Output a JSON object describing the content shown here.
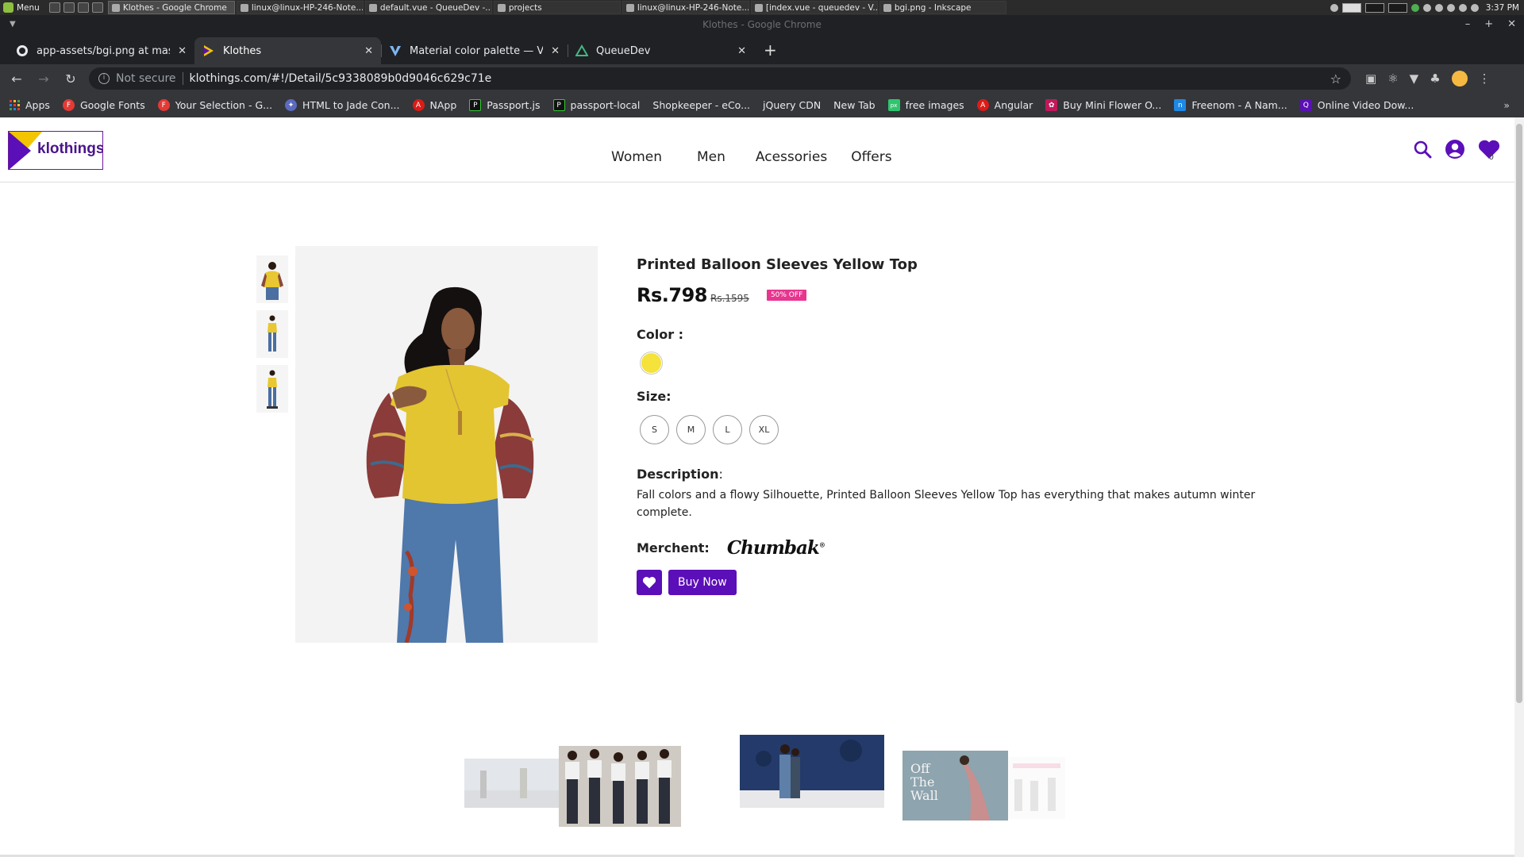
{
  "os_taskbar": {
    "menu_label": "Menu",
    "tasks": [
      {
        "label": "Klothes - Google Chrome",
        "active": true
      },
      {
        "label": "linux@linux-HP-246-Note...",
        "active": false
      },
      {
        "label": "default.vue - QueueDev -...",
        "active": false
      },
      {
        "label": "projects",
        "active": false
      },
      {
        "label": "linux@linux-HP-246-Note...",
        "active": false
      },
      {
        "label": "[index.vue - queuedev - V...",
        "active": false
      },
      {
        "label": "bgi.png - Inkscape",
        "active": false
      }
    ],
    "clock": "3:37 PM"
  },
  "window": {
    "title": "Klothes - Google Chrome"
  },
  "browser": {
    "tabs": [
      {
        "label": "app-assets/bgi.png at master ·",
        "icon": "github-icon",
        "active": false
      },
      {
        "label": "Klothes",
        "icon": "klothes-icon",
        "active": true
      },
      {
        "label": "Material color palette — Vuetify",
        "icon": "vuetify-icon",
        "active": false
      },
      {
        "label": "QueueDev",
        "icon": "queuedev-icon",
        "active": false
      }
    ],
    "security_label": "Not secure",
    "url": "klothings.com/#!/Detail/5c9338089b0d9046c629c71e",
    "bookmarks": [
      {
        "label": "Apps",
        "icon": "apps-grid-icon",
        "color": "#e8710a"
      },
      {
        "label": "Google Fonts",
        "icon": "google-fonts-icon",
        "color": "#e53935"
      },
      {
        "label": "Your Selection - G...",
        "icon": "google-fonts-icon",
        "color": "#e53935"
      },
      {
        "label": "HTML to Jade Con...",
        "icon": "converter-icon",
        "color": "#5c6bc0"
      },
      {
        "label": "NApp",
        "icon": "angular-icon",
        "color": "#dd1b16"
      },
      {
        "label": "Passport.js",
        "icon": "passport-icon",
        "color": "#111111"
      },
      {
        "label": "passport-local",
        "icon": "passport-icon",
        "color": "#111111"
      },
      {
        "label": "Shopkeeper - eCo...",
        "icon": "page-icon",
        "color": ""
      },
      {
        "label": "jQuery CDN",
        "icon": "page-icon",
        "color": ""
      },
      {
        "label": "New Tab",
        "icon": "page-icon",
        "color": ""
      },
      {
        "label": "free images",
        "icon": "pixabay-icon",
        "color": "#2ec66d"
      },
      {
        "label": "Angular",
        "icon": "angular-icon",
        "color": "#dd1b16"
      },
      {
        "label": "Buy Mini Flower O...",
        "icon": "gift-icon",
        "color": "#c2185b"
      },
      {
        "label": "Freenom - A Nam...",
        "icon": "freenom-icon",
        "color": "#1e88e5"
      },
      {
        "label": "Online Video Dow...",
        "icon": "video-download-icon",
        "color": "#5b0fb8"
      }
    ]
  },
  "site": {
    "brand": "klothings",
    "nav": [
      "Women",
      "Men",
      "Acessories",
      "Offers"
    ],
    "cart_count": "0",
    "accent": "#5b0fb8"
  },
  "product": {
    "title": "Printed Balloon Sleeves Yellow Top",
    "price": "Rs.798",
    "mrp": "Rs.1595",
    "discount": "50% OFF",
    "color_label": "Color :",
    "color_value": "#f5e23a",
    "size_label": "Size:",
    "sizes": [
      "S",
      "M",
      "L",
      "XL"
    ],
    "description_label": "Description",
    "description": "Fall colors and a flowy Silhouette, Printed Balloon Sleeves Yellow Top has everything that makes autumn winter complete.",
    "merchant_label": "Merchent:",
    "merchant": "Chumbak",
    "buy_label": "Buy Now",
    "thumbnail_count": 3
  },
  "banners": {
    "wall_text": "Off The Wall"
  }
}
